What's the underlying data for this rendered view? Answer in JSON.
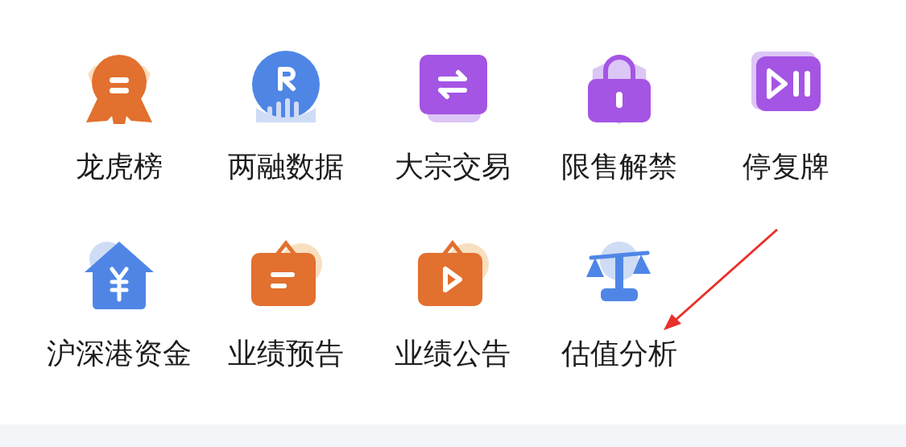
{
  "grid": [
    {
      "label": "龙虎榜"
    },
    {
      "label": "两融数据"
    },
    {
      "label": "大宗交易"
    },
    {
      "label": "限售解禁"
    },
    {
      "label": "停复牌"
    },
    {
      "label": "沪深港资金"
    },
    {
      "label": "业绩预告"
    },
    {
      "label": "业绩公告"
    },
    {
      "label": "估值分析"
    }
  ]
}
